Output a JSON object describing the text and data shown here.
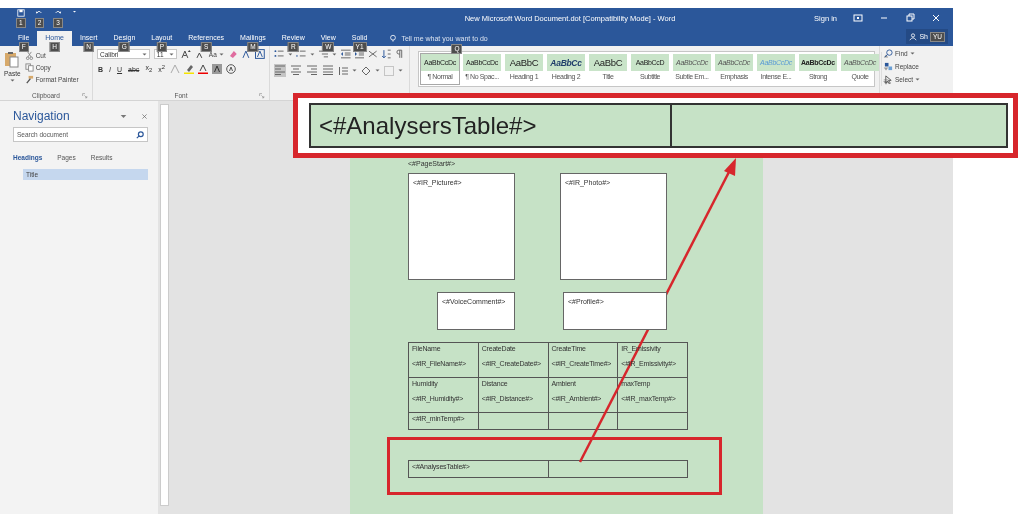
{
  "window": {
    "title": "New Microsoft Word Document.dot [Compatibility Mode] - Word",
    "sign_in": "Sign in",
    "quick_access_keytips": [
      "1",
      "2",
      "3"
    ],
    "share": {
      "label": "Sh",
      "keytip": "YU"
    }
  },
  "tabs": [
    {
      "label": "File",
      "keytip": "F",
      "selected": false
    },
    {
      "label": "Home",
      "keytip": "H",
      "selected": true
    },
    {
      "label": "Insert",
      "keytip": "N",
      "selected": false
    },
    {
      "label": "Design",
      "keytip": "G",
      "selected": false
    },
    {
      "label": "Layout",
      "keytip": "P",
      "selected": false
    },
    {
      "label": "References",
      "keytip": "S",
      "selected": false
    },
    {
      "label": "Mailings",
      "keytip": "M",
      "selected": false
    },
    {
      "label": "Review",
      "keytip": "R",
      "selected": false
    },
    {
      "label": "View",
      "keytip": "W",
      "selected": false
    },
    {
      "label": "Solid",
      "keytip": "Y1",
      "selected": false
    }
  ],
  "tell_me": {
    "placeholder": "Tell me what you want to do",
    "keytip": "Q"
  },
  "clipboard": {
    "paste": "Paste",
    "cut": "Cut",
    "copy": "Copy",
    "format_painter": "Format Painter",
    "label": "Clipboard"
  },
  "font": {
    "name": "Calibri",
    "size": "11",
    "change_case": "Aa",
    "buttons": [
      "B",
      "I",
      "U",
      "abc",
      "x$_{2}$",
      "x$^{2}$"
    ],
    "label": "Font"
  },
  "paragraph": {
    "alignments": [
      {
        "selected": true
      },
      {
        "selected": false
      },
      {
        "selected": false
      },
      {
        "selected": false
      }
    ]
  },
  "styles": [
    {
      "preview": "AaBbCcDc",
      "name": "¶ Normal",
      "kind": "small",
      "selected": true
    },
    {
      "preview": "AaBbCcDc",
      "name": "¶ No Spac...",
      "kind": "small",
      "selected": false
    },
    {
      "preview": "AaBbC",
      "name": "Heading 1",
      "kind": "large",
      "selected": false
    },
    {
      "preview": "AaBbCc",
      "name": "Heading 2",
      "kind": "italic",
      "selected": false
    },
    {
      "preview": "AaBbC",
      "name": "Title",
      "kind": "large",
      "selected": false
    },
    {
      "preview": "AaBbCcD",
      "name": "Subtitle",
      "kind": "small",
      "selected": false
    },
    {
      "preview": "AaBbCcDc",
      "name": "Subtle Em...",
      "kind": "italic-small",
      "selected": false
    },
    {
      "preview": "AaBbCcDc",
      "name": "Emphasis",
      "kind": "italic-small",
      "selected": false
    },
    {
      "preview": "AaBbCcDc",
      "name": "Intense E...",
      "kind": "accent",
      "selected": false
    },
    {
      "preview": "AaBbCcDc",
      "name": "Strong",
      "kind": "bold",
      "selected": false
    },
    {
      "preview": "AaBbCcDc",
      "name": "Quote",
      "kind": "italic-small",
      "selected": false
    }
  ],
  "editing": {
    "find": "Find",
    "replace": "Replace",
    "select": "Select"
  },
  "navigation": {
    "title": "Navigation",
    "search": {
      "placeholder": "Search document"
    },
    "tabs": [
      {
        "label": "Headings",
        "selected": true
      },
      {
        "label": "Pages",
        "selected": false
      },
      {
        "label": "Results",
        "selected": false
      }
    ],
    "items": [
      {
        "label": "Title",
        "selected": true
      }
    ]
  },
  "document": {
    "page_start": "<#PageStart#>",
    "picture": "<#IR_Picture#>",
    "photo": "<#IR_Photo#>",
    "voice_comment": "<#VoiceComment#>",
    "profile": "<#Profile#>",
    "fields_table": {
      "rows": [
        [
          {
            "label": "FileName",
            "value": "<#IR_FileName#>"
          },
          {
            "label": "CreateDate",
            "value": "<#IR_CreateDate#>"
          },
          {
            "label": "CreateTime",
            "value": "<#IR_CreateTime#>"
          },
          {
            "label": "IR_Emissivity",
            "value": "<#IR_Emissivity#>"
          }
        ],
        [
          {
            "label": "Humidity",
            "value": "<#IR_Humidity#>"
          },
          {
            "label": "Distance",
            "value": "<#IR_Distance#>"
          },
          {
            "label": "Ambient",
            "value": "<#IR_Ambient#>"
          },
          {
            "label": "maxTemp",
            "value": "<#IR_maxTemp#>"
          }
        ],
        [
          {
            "value": "<#IR_minTemp#>"
          }
        ]
      ]
    },
    "analyses_table": "<#AnalysesTable#>"
  },
  "callout": {
    "text": "<#AnalysersTable#>"
  }
}
